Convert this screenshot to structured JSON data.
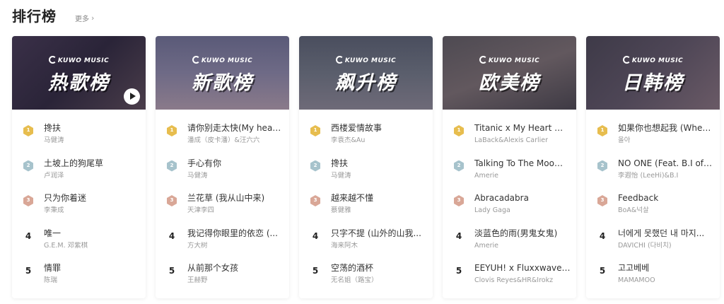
{
  "header": {
    "title": "排行榜",
    "more_label": "更多",
    "more_chevron": "›"
  },
  "brand": {
    "logo_text": "KUWO MUSIC"
  },
  "colors": {
    "gold": "#e7bd4e",
    "silver": "#a7c3cc",
    "bronze": "#d9a797"
  },
  "charts": [
    {
      "name": "热歌榜",
      "cover_bg": "linear-gradient(135deg,#3a3048 0%,#2a2438 50%,#4a3d4a 100%)",
      "has_play": true,
      "songs": [
        {
          "rank": "1",
          "title": "搀扶",
          "artist": "马健涛"
        },
        {
          "rank": "2",
          "title": "土坡上的狗尾草",
          "artist": "卢润泽"
        },
        {
          "rank": "3",
          "title": "只为你着迷",
          "artist": "李秉成"
        },
        {
          "rank": "4",
          "title": "唯一",
          "artist": "G.E.M. 邓紫棋"
        },
        {
          "rank": "5",
          "title": "情罪",
          "artist": "陈瑞"
        }
      ]
    },
    {
      "name": "新歌榜",
      "cover_bg": "linear-gradient(180deg,#5a5a78 0%,#6e6a86 50%,#8a7a8a 100%)",
      "has_play": false,
      "songs": [
        {
          "rank": "1",
          "title": "请你别走太快(My heart...",
          "artist": "潘成（皮卡潘）&汪六六"
        },
        {
          "rank": "2",
          "title": "手心有你",
          "artist": "马健涛"
        },
        {
          "rank": "3",
          "title": "兰花草 (我从山中来)",
          "artist": "天津李四"
        },
        {
          "rank": "4",
          "title": "我记得你眼里的依恋 (...",
          "artist": "方大树"
        },
        {
          "rank": "5",
          "title": "从前那个女孩",
          "artist": "王赫野"
        }
      ]
    },
    {
      "name": "飙升榜",
      "cover_bg": "linear-gradient(180deg,#4a4e5e 0%,#5a5e6c 50%,#6e6a78 100%)",
      "has_play": false,
      "songs": [
        {
          "rank": "1",
          "title": "西楼爱情故事",
          "artist": "李袁杰&Au"
        },
        {
          "rank": "2",
          "title": "搀扶",
          "artist": "马健涛"
        },
        {
          "rank": "3",
          "title": "越来越不懂",
          "artist": "蔡健雅"
        },
        {
          "rank": "4",
          "title": "只字不提 (山外的山我...",
          "artist": "海来阿木"
        },
        {
          "rank": "5",
          "title": "空荡的酒杯",
          "artist": "无名姐（路宝）"
        }
      ]
    },
    {
      "name": "欧美榜",
      "cover_bg": "linear-gradient(160deg,#4e4a52 0%,#62585e 50%,#3e3a44 100%)",
      "has_play": false,
      "songs": [
        {
          "rank": "1",
          "title": "Titanic x My Heart Wi...",
          "artist": "LaBack&Alexis Carlier"
        },
        {
          "rank": "2",
          "title": "Talking To The Moom...",
          "artist": "Amerie"
        },
        {
          "rank": "3",
          "title": "Abracadabra",
          "artist": "Lady Gaga"
        },
        {
          "rank": "4",
          "title": "淡蓝色的雨(男鬼女鬼)",
          "artist": "Amerie"
        },
        {
          "rank": "5",
          "title": "EEYUH! x Fluxxwave(S...",
          "artist": "Clovis Reyes&HR&Irokz"
        }
      ]
    },
    {
      "name": "日韩榜",
      "cover_bg": "linear-gradient(135deg,#3e3a48 0%,#4e4656 50%,#6a5a66 100%)",
      "has_play": false,
      "songs": [
        {
          "rank": "1",
          "title": "如果你也想起我 (When...",
          "artist": "올아"
        },
        {
          "rank": "2",
          "title": "NO ONE (Feat. B.I of i...",
          "artist": "李遐怡 (LeeHi)&B.I"
        },
        {
          "rank": "3",
          "title": "Feedback",
          "artist": "BoA&넉살"
        },
        {
          "rank": "4",
          "title": "너에게 못했던 내 마지...",
          "artist": "DAVICHI (다비치)"
        },
        {
          "rank": "5",
          "title": "고고베베",
          "artist": "MAMAMOO"
        }
      ]
    }
  ]
}
